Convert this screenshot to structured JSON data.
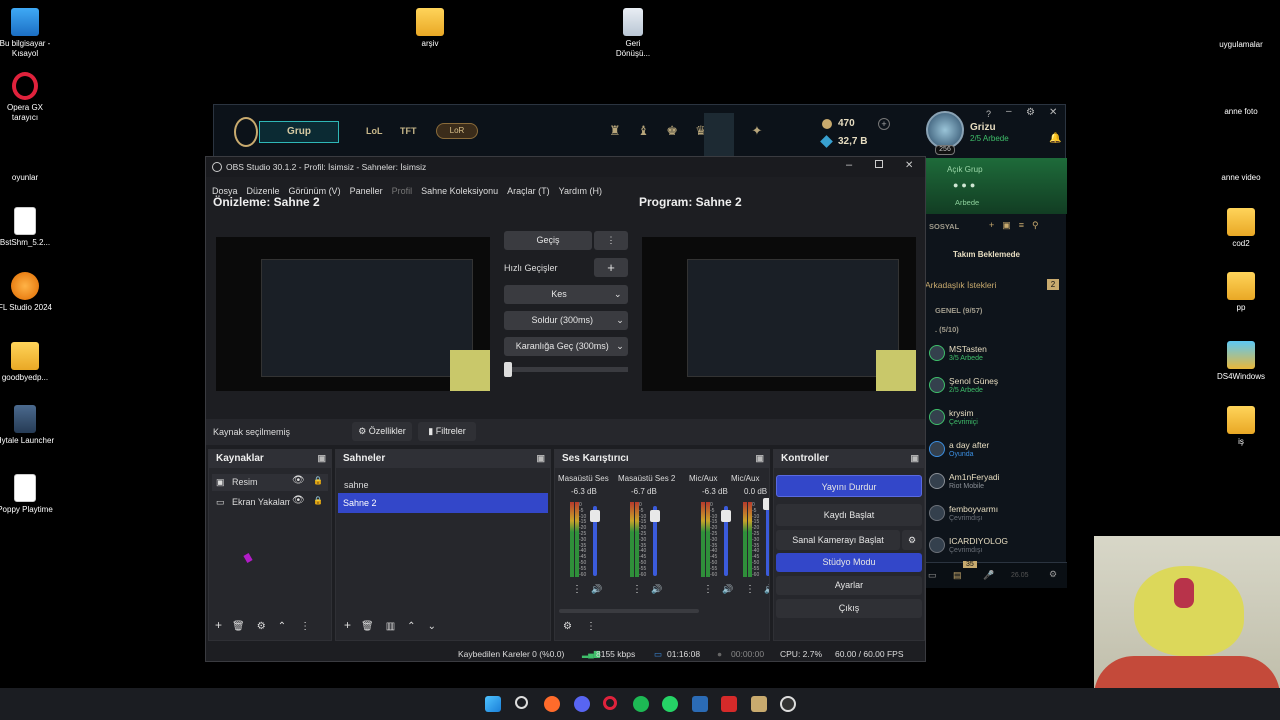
{
  "desktop": {
    "icons": [
      {
        "label": "Bu bilgisayar - Kısayol"
      },
      {
        "label": "Opera GX tarayıcı"
      },
      {
        "label": "oyunlar"
      },
      {
        "label": "BstShm_5.2..."
      },
      {
        "label": "FL Studio 2024"
      },
      {
        "label": "goodbyedp..."
      },
      {
        "label": "Hytale Launcher"
      },
      {
        "label": "Poppy Playtime"
      },
      {
        "label": "arşiv"
      },
      {
        "label": "Geri Dönüşü..."
      },
      {
        "label": "uygulamalar"
      },
      {
        "label": "anne foto"
      },
      {
        "label": "anne video"
      },
      {
        "label": "cod2"
      },
      {
        "label": "pp"
      },
      {
        "label": "DS4Windows"
      },
      {
        "label": "iş"
      }
    ]
  },
  "lol": {
    "grup": "Grup",
    "lol": "LoL",
    "tft": "TFT",
    "lor": "LoR",
    "rp": "470",
    "be": "32,7 B",
    "username": "Grizu",
    "status": "2/5 Arbede",
    "level": "256",
    "help": "?",
    "open_group": "Açık Grup",
    "arbede": "Arbede",
    "social": "SOSYAL",
    "team_waiting": "Takım Beklemede",
    "friend_requests": "Arkadaşlık İstekleri",
    "friend_requests_count": "2",
    "general": "GENEL (9/57)",
    "sub": ". (5/10)",
    "friends": [
      {
        "name": "MSTasten",
        "status": "3/5 Arbede",
        "color": "#3fbf6a"
      },
      {
        "name": "Şenol Güneş",
        "status": "2/5 Arbede",
        "color": "#3fbf6a"
      },
      {
        "name": "krysim",
        "status": "Çevrimiçi",
        "color": "#3fbf6a"
      },
      {
        "name": "a day after",
        "status": "Oyunda",
        "color": "#3b8ee0"
      },
      {
        "name": "Am1nFeryadi",
        "status": "Riot Mobile",
        "color": "#8a8f96"
      },
      {
        "name": "femboyvarmı",
        "status": "Çevrimdışı",
        "color": "#6b7078"
      },
      {
        "name": "ICARDIYOLOG",
        "status": "Çevrimdışı",
        "color": "#6b7078"
      }
    ],
    "bottom_badge": "35",
    "bottom_version": "26.05"
  },
  "obs": {
    "title": "OBS Studio 30.1.2 - Profil: İsimsiz - Sahneler: İsimsiz",
    "menu": [
      "Dosya",
      "Düzenle",
      "Görünüm (V)",
      "Paneller",
      "Profil",
      "Sahne Koleksiyonu",
      "Araçlar (T)",
      "Yardım (H)"
    ],
    "preview_label": "Önizleme: Sahne 2",
    "program_label": "Program: Sahne 2",
    "transition": "Geçiş",
    "quick_transitions": "Hızlı Geçişler",
    "cut": "Kes",
    "fade": "Soldur (300ms)",
    "fade_black": "Karanlığa Geç (300ms)",
    "no_source": "Kaynak seçilmemiş",
    "properties": "Özellikler",
    "filters": "Filtreler",
    "sources": {
      "title": "Kaynaklar",
      "items": [
        {
          "label": "Resim"
        },
        {
          "label": "Ekran Yakalam"
        }
      ]
    },
    "scenes": {
      "title": "Sahneler",
      "items": [
        {
          "label": "sahne"
        },
        {
          "label": "Sahne 2"
        }
      ]
    },
    "mixer": {
      "title": "Ses Karıştırıcı",
      "channels": [
        {
          "name": "Masaüstü Ses",
          "db": "-6.3 dB"
        },
        {
          "name": "Masaüstü Ses 2",
          "db": "-6.7 dB"
        },
        {
          "name": "Mic/Aux",
          "db": "-6.3 dB"
        },
        {
          "name": "Mic/Aux",
          "db": "0.0 dB"
        }
      ],
      "scale": [
        "0",
        "-5",
        "-10",
        "-15",
        "-20",
        "-25",
        "-30",
        "-35",
        "-40",
        "-45",
        "-50",
        "-55",
        "-60"
      ]
    },
    "controls": {
      "title": "Kontroller",
      "stop_stream": "Yayını Durdur",
      "start_record": "Kaydı Başlat",
      "virtual_cam": "Sanal Kamerayı Başlat",
      "studio_mode": "Stüdyo Modu",
      "settings": "Ayarlar",
      "exit": "Çıkış"
    },
    "status": {
      "dropped": "Kaybedilen Kareler 0 (%0.0)",
      "bitrate": "8155 kbps",
      "stream_time": "01:16:08",
      "rec_time": "00:00:00",
      "cpu": "CPU: 2.7%",
      "fps": "60.00 / 60.00 FPS"
    }
  },
  "colors": {
    "obs_accent": "#3347c9",
    "lol_gold": "#c8aa6e",
    "lol_green": "#1e6b3a"
  }
}
